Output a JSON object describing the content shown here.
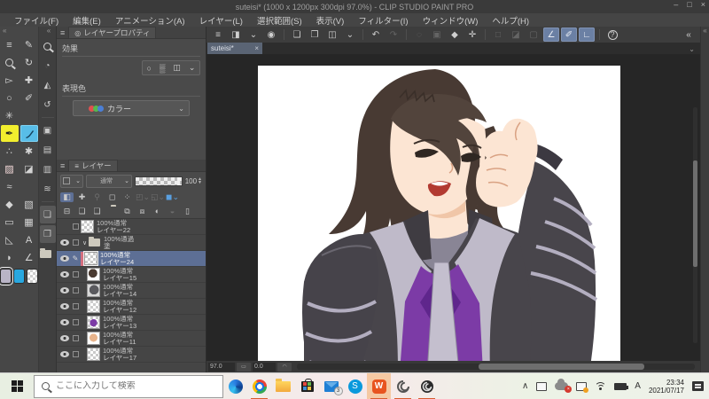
{
  "window": {
    "title": "suteisi* (1000 x 1200px 300dpi 97.0%) - CLIP STUDIO PAINT PRO",
    "minimize": "–",
    "maximize": "□",
    "close": "×"
  },
  "menubar": {
    "items": [
      {
        "label": "ファイル(F)"
      },
      {
        "label": "編集(E)"
      },
      {
        "label": "アニメーション(A)"
      },
      {
        "label": "レイヤー(L)"
      },
      {
        "label": "選択範囲(S)"
      },
      {
        "label": "表示(V)"
      },
      {
        "label": "フィルター(I)"
      },
      {
        "label": "ウィンドウ(W)"
      },
      {
        "label": "ヘルプ(H)"
      }
    ]
  },
  "commandbar": {
    "menu": "≡",
    "workspace": "◨",
    "chevron": "⌄",
    "clipstudio": "◉",
    "new": "❏",
    "open": "❐",
    "save": "◫",
    "undo": "↶",
    "redo": "↷",
    "busy": "◌",
    "special": "▣",
    "fill": "◆",
    "crop": "✛",
    "sel1": "□",
    "sel2": "◪",
    "sel3": "▢",
    "snap_ruler": "∠",
    "snap_special": "✐",
    "snap_grid": "∟",
    "help": "?",
    "collapse": "«"
  },
  "toolstrip": {
    "collapse": "«",
    "panel_menu": "≡",
    "current_tool": "✎",
    "rotate": "↻",
    "object": "▻",
    "move": "✚",
    "lasso": "○",
    "eyedropper": "✐",
    "wand": "✳",
    "pen": "✒",
    "airbrush": "∴",
    "decoration": "✱",
    "selection_pen": "▨",
    "eraser": "◪",
    "blend": "≈",
    "bucket": "◆",
    "gradient": "▧",
    "figure": "▭",
    "frame": "▦",
    "polyline": "◺",
    "text": "A",
    "balloon": "◗",
    "line_correct": "∠"
  },
  "dockstrip": {
    "collapse": "«",
    "navigator": "◔",
    "subview_flip": "◭",
    "history": "↺",
    "material1": "▣",
    "material2": "▤",
    "material3": "▥",
    "tone": "≋",
    "layer_search": "❏",
    "layer_template": "❐"
  },
  "layer_property": {
    "tab": "レイヤープロパティ",
    "effect_label": "効果",
    "effect_icons": {
      "border": "○",
      "tone": "▒",
      "layer_color": "◫",
      "chevron": "⌄"
    },
    "expression_label": "表現色",
    "color_option": "カラー",
    "chevron": "⌄"
  },
  "layer_panel": {
    "tab": "レイヤー",
    "blend_mode": "通常",
    "opacity": "100",
    "rows": [
      {
        "mode": "100%通常",
        "name": "レイヤー22"
      },
      {
        "mode": "100%通過",
        "name": "塗"
      },
      {
        "mode": "100%通常",
        "name": "レイヤー24"
      },
      {
        "mode": "100%通常",
        "name": "レイヤー15"
      },
      {
        "mode": "100%通常",
        "name": "レイヤー14"
      },
      {
        "mode": "100%通常",
        "name": "レイヤー12"
      },
      {
        "mode": "100%通常",
        "name": "レイヤー13"
      },
      {
        "mode": "100%通常",
        "name": "レイヤー11"
      },
      {
        "mode": "100%通常",
        "name": "レイヤー17"
      }
    ],
    "expander": "∨",
    "pen_mark": "✎"
  },
  "canvas": {
    "tab": "suteisi*",
    "tab_close": "×",
    "tab_caret": "⌄",
    "zoom": "97.0",
    "rotation": "0.0"
  },
  "taskbar": {
    "search_placeholder": "ここに入力して検索",
    "mail_badge": "3",
    "skype_letter": "S",
    "w_letter": "W",
    "tray_chevron": "∧",
    "ime": "A",
    "time": "23:34",
    "date": "2021/07/17"
  },
  "colors": {
    "selected_layer_row": "#5d6f95",
    "tool_pen_highlight": "#f2ee2e",
    "tool_brush_highlight": "#58bde8",
    "snap_button_on": "#6b80a4",
    "taskbar_active_tile": "#f5c9a3",
    "taskbar_underline": "#d85b2e"
  },
  "artwork": {
    "description": "anime portrait - person with brown hair, hand raised to face, dark jacket with purple vest",
    "hair": "#483a33",
    "hair_front": "#52443c",
    "skin": "#fce5d3",
    "skin_shadow": "#f0c6a8",
    "jacket": "#48454b",
    "trim": "#bfbac9",
    "inner_collar": "#898595",
    "vest": "#7c3ba6",
    "diamond": "#5f268c",
    "mouth": "#b23a31",
    "background": "#ffffff"
  }
}
